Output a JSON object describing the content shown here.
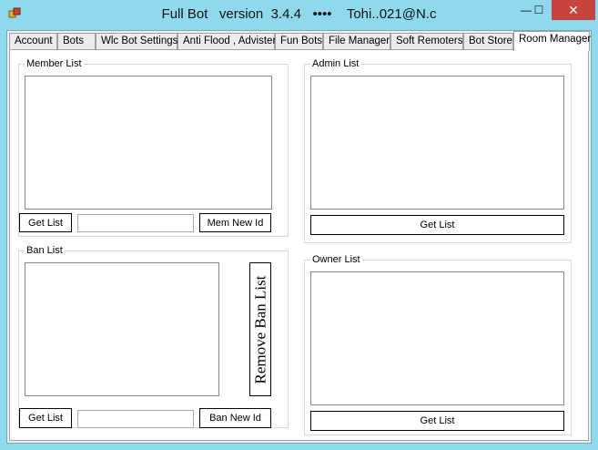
{
  "window": {
    "title": "Full Bot   version  3.4.4   ••••    Tohi..021@N.c",
    "minimize_glyph": "—",
    "maximize_glyph": "☐",
    "close_glyph": "✕"
  },
  "tabs": [
    {
      "label": "Account",
      "active": false
    },
    {
      "label": "Bots",
      "active": false
    },
    {
      "label": "Wlc Bot Settings",
      "active": false
    },
    {
      "label": "Anti Flood , Advister",
      "active": false
    },
    {
      "label": "Fun Bots",
      "active": false
    },
    {
      "label": "File Manager",
      "active": false
    },
    {
      "label": "Soft Remoters",
      "active": false
    },
    {
      "label": "Bot Store",
      "active": false
    },
    {
      "label": "Room Manager",
      "active": true
    }
  ],
  "member_list": {
    "title": "Member List",
    "get_list": "Get List",
    "input_value": "",
    "action": "Mem New Id"
  },
  "ban_list": {
    "title": "Ban List",
    "remove": "Remove Ban List",
    "get_list": "Get List",
    "input_value": "",
    "action": "Ban New Id"
  },
  "admin_list": {
    "title": "Admin List",
    "get_list": "Get List"
  },
  "owner_list": {
    "title": "Owner List",
    "get_list": "Get List"
  }
}
